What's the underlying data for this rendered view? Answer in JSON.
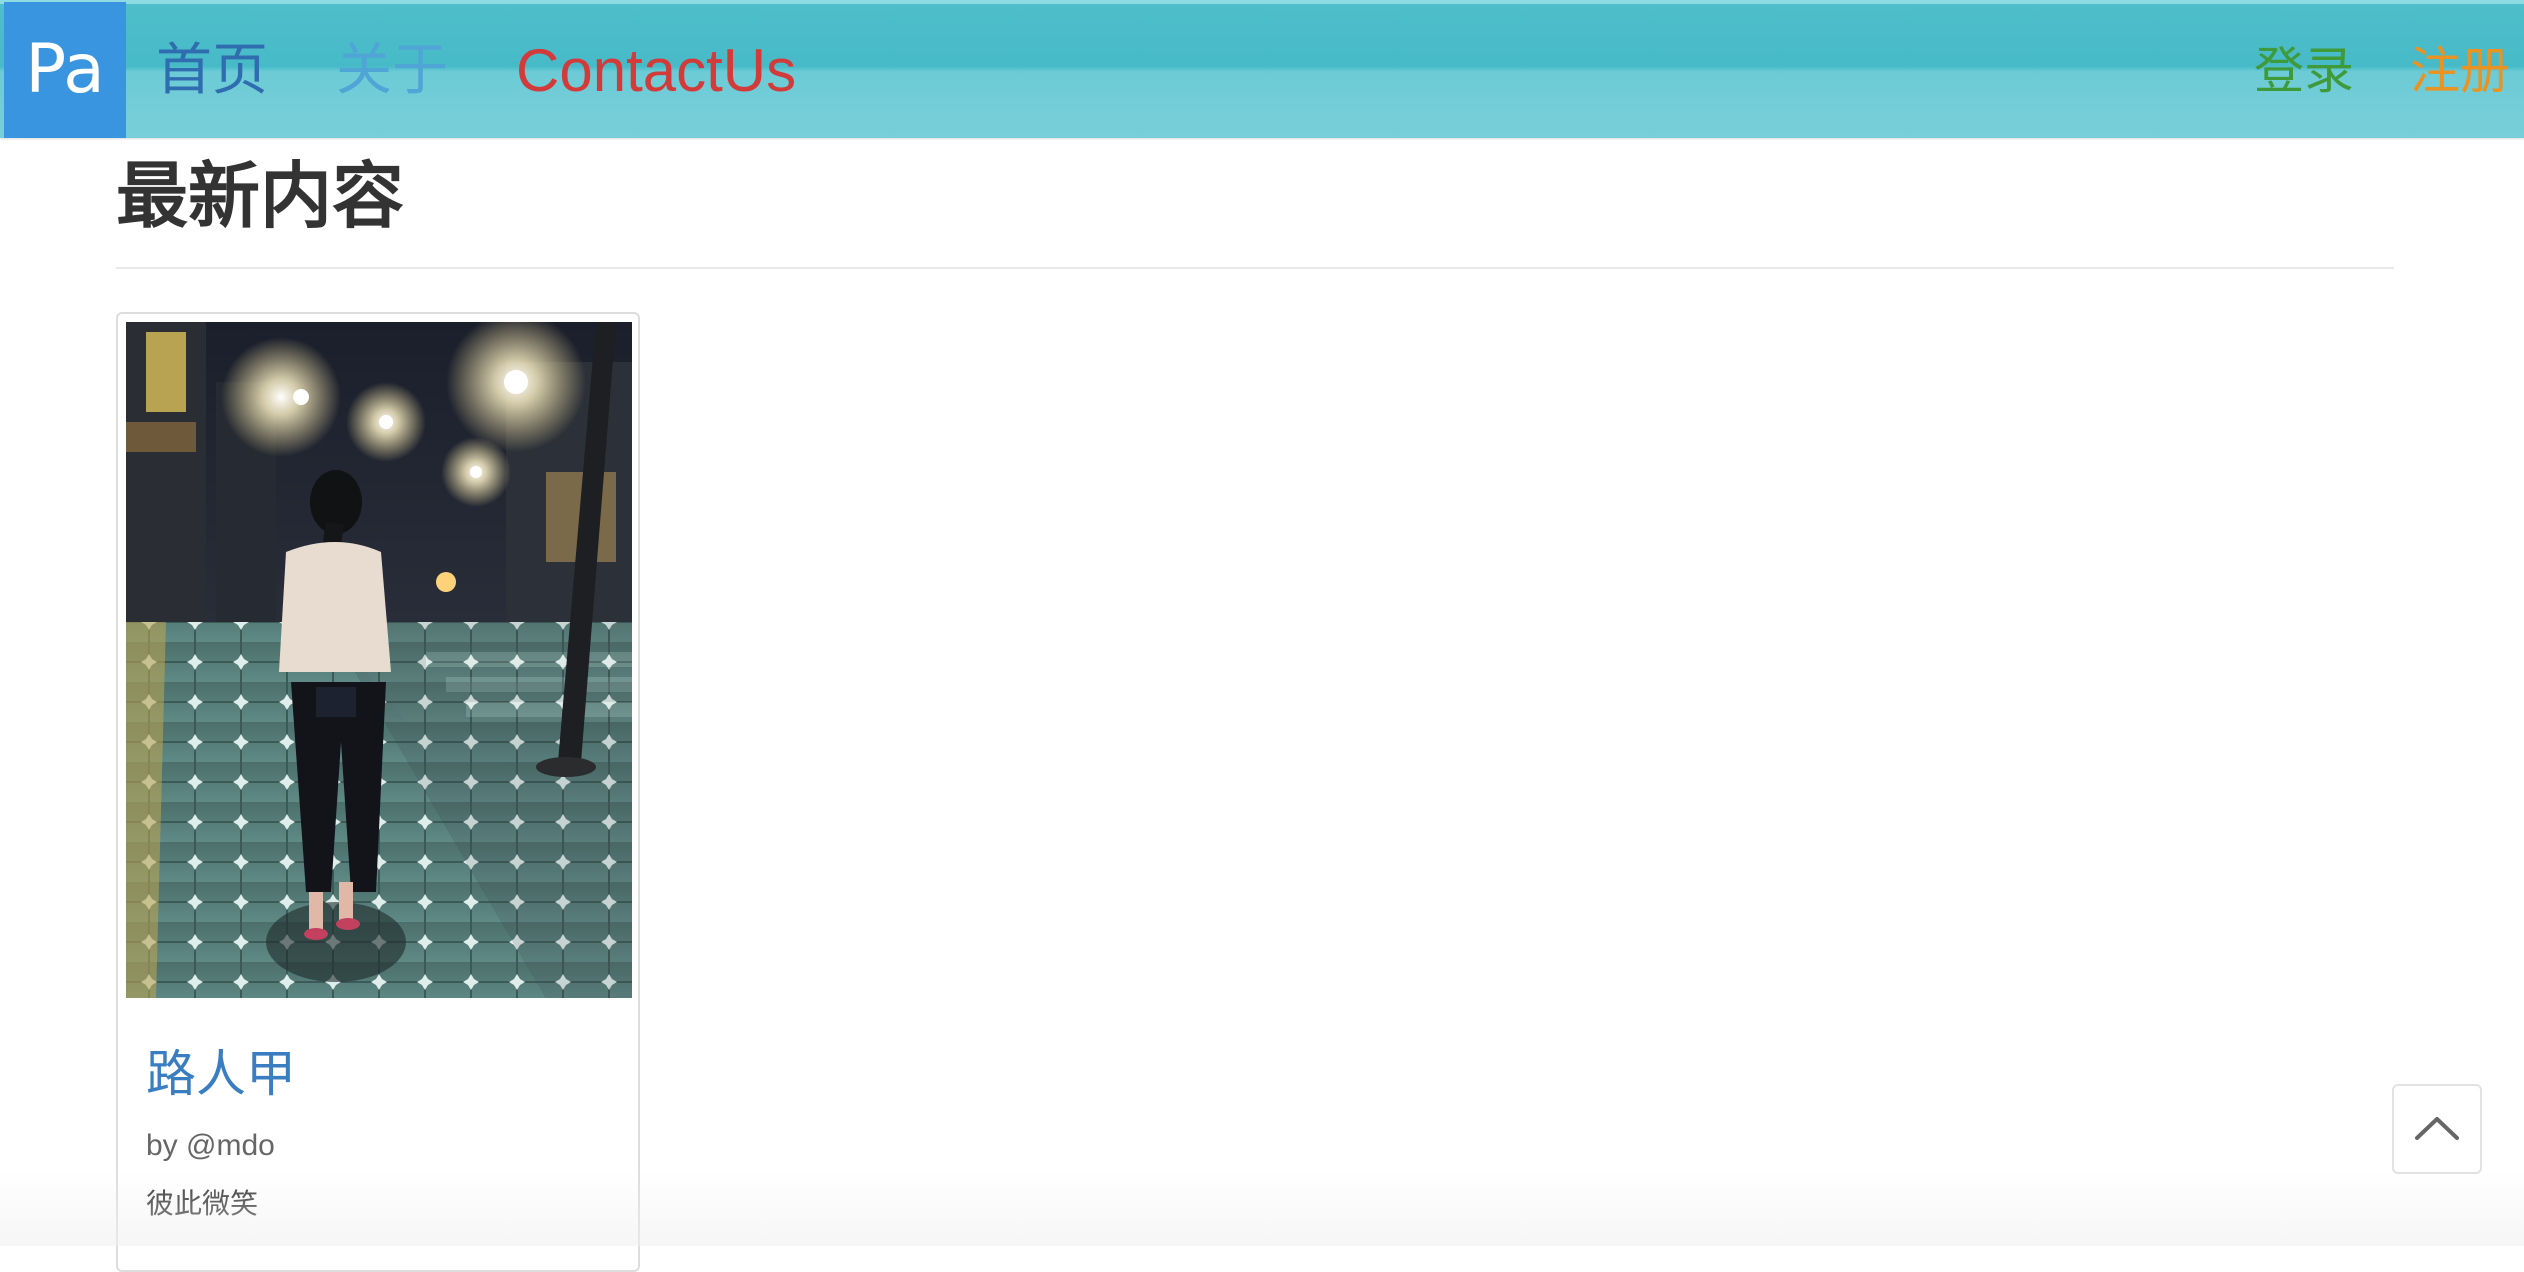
{
  "navbar": {
    "brand": "Pa",
    "links": [
      {
        "label": "首页",
        "color": "#2f6db0"
      },
      {
        "label": "关于",
        "color": "#4fa5d6"
      },
      {
        "label": "ContactUs",
        "color": "#d33a3a"
      }
    ],
    "login": "登录",
    "register": "注册",
    "background": "#4fbecb",
    "brand_background": "#3a95e0"
  },
  "main": {
    "heading": "最新内容",
    "cards": [
      {
        "image": "photo of a woman walking on a night street sidewalk",
        "title": "路人甲",
        "author": "by @mdo",
        "description": "彼此微笑"
      }
    ]
  },
  "back_to_top": {
    "icon": "chevron-up-icon"
  }
}
